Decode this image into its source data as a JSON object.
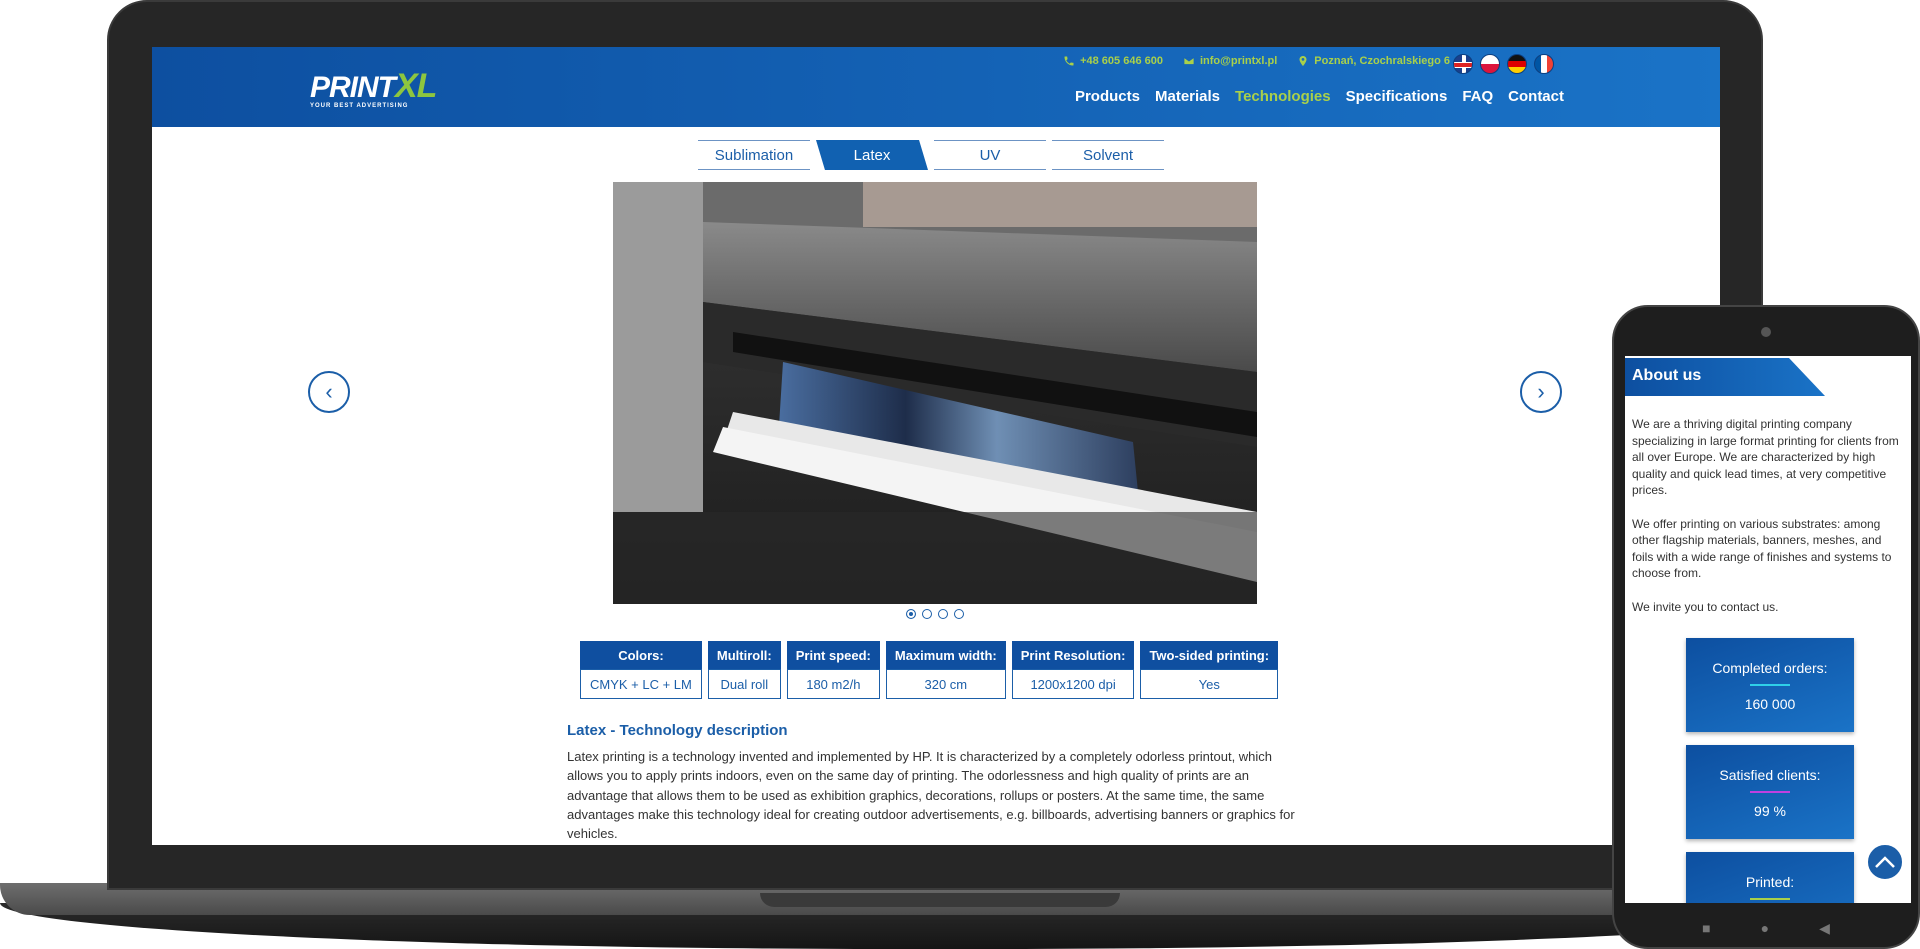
{
  "header": {
    "logo_main": "PRINT",
    "logo_accent": "XL",
    "logo_tagline": "YOUR BEST ADVERTISING",
    "phone": "+48 605 646 600",
    "email": "info@printxl.pl",
    "address": "Poznań, Czochralskiego 6",
    "flags": [
      "en-flag",
      "pl-flag",
      "de-flag",
      "fr-flag"
    ],
    "nav": [
      "Products",
      "Materials",
      "Technologies",
      "Specifications",
      "FAQ",
      "Contact"
    ],
    "nav_active": "Technologies",
    "brand_blue": "#1161b1",
    "accent_green": "#a9d04a"
  },
  "tabs": [
    "Sublimation",
    "Latex",
    "UV",
    "Solvent"
  ],
  "tab_active": "Latex",
  "carousel": {
    "prev_icon": "‹",
    "next_icon": "›",
    "slide_count": 4,
    "active_slide": 1,
    "image_subject": "large-format latex printer printing a banner"
  },
  "specs": [
    {
      "label": "Colors:",
      "value": "CMYK + LC + LM"
    },
    {
      "label": "Multiroll:",
      "value": "Dual roll"
    },
    {
      "label": "Print speed:",
      "value": "180 m2/h"
    },
    {
      "label": "Maximum width:",
      "value": "320 cm"
    },
    {
      "label": "Print Resolution:",
      "value": "1200x1200 dpi"
    },
    {
      "label": "Two-sided printing:",
      "value": "Yes"
    }
  ],
  "description": {
    "title": "Latex - Technology description",
    "body": "Latex printing is a technology invented and implemented by HP. It is characterized by a completely odorless printout, which allows you to apply prints indoors, even on the same day of printing. The odorlessness and high quality of prints are an advantage that allows them to be used as exhibition graphics, decorations, rollups or posters. At the same time, the same advantages make this technology ideal for creating outdoor advertisements, e.g. billboards, advertising banners or graphics for vehicles."
  },
  "mobile": {
    "about_title": "About us",
    "paragraphs": [
      "We are a thriving digital printing company specializing in large format printing for clients from all over Europe. We are characterized by high quality and quick lead times, at very competitive prices.",
      "We offer printing on various substrates: among other flagship materials, banners, meshes, and foils with a wide range of finishes and systems to choose from.",
      "We invite you to contact us."
    ],
    "stats": [
      {
        "label": "Completed orders:",
        "value": "160 000",
        "line_color": "#2fd0e8"
      },
      {
        "label": "Satisfied clients:",
        "value": "99 %",
        "line_color": "#c040e0"
      },
      {
        "label": "Printed:",
        "value": "",
        "line_color": "#a9d04a"
      }
    ]
  }
}
